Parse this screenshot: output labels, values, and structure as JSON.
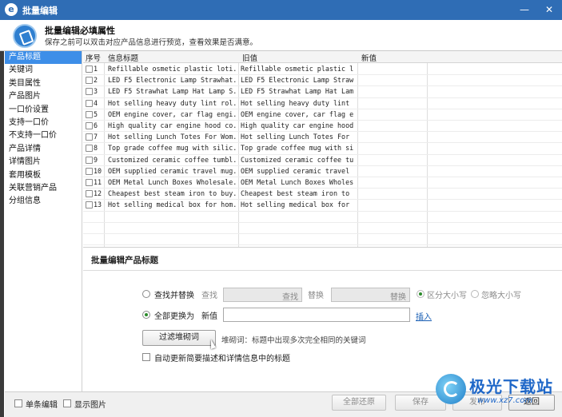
{
  "window": {
    "title": "批量编辑",
    "controls": [
      "—",
      "✕"
    ]
  },
  "header": {
    "title": "批量编辑必填属性",
    "subtitle": "保存之前可以双击对应产品信息进行预览，查看效果是否满意。"
  },
  "sidebar": {
    "items": [
      {
        "label": "产品标题",
        "active": true
      },
      {
        "label": "关键词"
      },
      {
        "label": "类目属性"
      },
      {
        "label": "产品图片"
      },
      {
        "label": "一口价设置"
      },
      {
        "label": "支持一口价"
      },
      {
        "label": "不支持一口价"
      },
      {
        "label": "产品详情"
      },
      {
        "label": "详情图片"
      },
      {
        "label": "套用模板"
      },
      {
        "label": "关联营销产品"
      },
      {
        "label": "分组信息"
      }
    ]
  },
  "grid": {
    "columns": [
      "序号",
      "信息标题",
      "旧值",
      "新值"
    ],
    "rows": [
      {
        "num": "1",
        "title": "Refillable osmetic plastic loti...",
        "old": "Refillable osmetic plastic l..."
      },
      {
        "num": "2",
        "title": "LED F5 Electronic Lamp Strawhat...",
        "old": "LED F5 Electronic Lamp Straw..."
      },
      {
        "num": "3",
        "title": "LED F5 Strawhat Lamp Hat Lamp S...",
        "old": "LED F5 Strawhat Lamp Hat Lam..."
      },
      {
        "num": "4",
        "title": "Hot selling heavy duty lint rol...",
        "old": "Hot selling heavy duty lint ..."
      },
      {
        "num": "5",
        "title": "OEM engine cover, car flag engi...",
        "old": "OEM engine cover, car flag e..."
      },
      {
        "num": "6",
        "title": "High quality car engine hood co...",
        "old": "High quality car engine hood..."
      },
      {
        "num": "7",
        "title": "Hot selling Lunch Totes For Wom...",
        "old": "Hot selling Lunch Totes For ..."
      },
      {
        "num": "8",
        "title": "Top grade coffee mug with silic...",
        "old": "Top grade coffee mug with si..."
      },
      {
        "num": "9",
        "title": "Customized ceramic coffee tumbl...",
        "old": "Customized ceramic coffee tu..."
      },
      {
        "num": "10",
        "title": "OEM supplied ceramic travel mug...",
        "old": "OEM supplied ceramic travel ..."
      },
      {
        "num": "11",
        "title": "OEM Metal Lunch Boxes Wholesale...",
        "old": "OEM Metal Lunch Boxes Wholes..."
      },
      {
        "num": "12",
        "title": "Cheapest best steam iron to buy...",
        "old": "Cheapest best steam iron to ..."
      },
      {
        "num": "13",
        "title": "Hot selling medical box for hom...",
        "old": "Hot selling medical box for ..."
      }
    ]
  },
  "editor": {
    "section_title": "批量编辑产品标题",
    "find_replace_label": "查找并替换",
    "find_label": "查找",
    "find_btn": "查找",
    "replace_label": "替换",
    "replace_btn": "替换",
    "case_sensitive": "区分大小写",
    "ignore_case": "忽略大小写",
    "replace_all_label": "全部更换为",
    "new_value_label": "新值",
    "new_value": "",
    "insert_link": "插入",
    "filter_btn": "过滤堆砌词",
    "filter_hint": "堆砌词：标题中出现多次完全相同的关键词",
    "auto_update_label": "自动更新简要描述和详情信息中的标题"
  },
  "footer": {
    "single_edit": "单条编辑",
    "show_images": "显示图片",
    "restore_all": "全部还原",
    "save": "保存",
    "cancel": "发布",
    "back": "返回"
  },
  "watermark": {
    "text": "极光下载站",
    "url": "www.xz7.com"
  }
}
